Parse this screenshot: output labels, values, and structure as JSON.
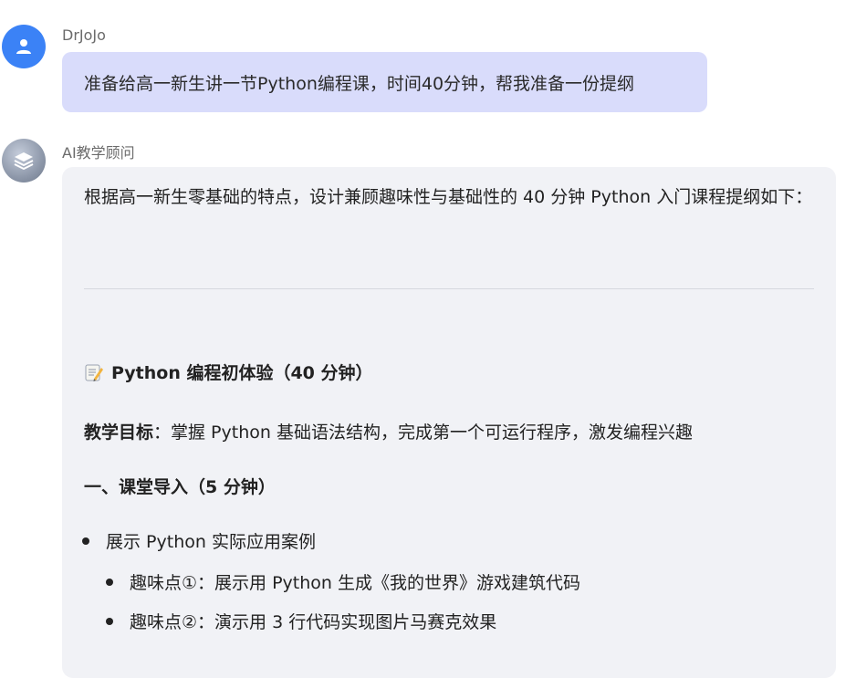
{
  "conversation": {
    "user": {
      "name": "DrJoJo",
      "icon": "user-icon",
      "avatar_color": "#3b82f6",
      "message": "准备给高一新生讲一节Python编程课，时间40分钟，帮我准备一份提纲"
    },
    "assistant": {
      "name": "AI教学顾问",
      "icon": "layers-icon",
      "intro": "根据高一新生零基础的特点，设计兼顾趣味性与基础性的 40 分钟 Python 入门课程提纲如下：",
      "course_title": "Python 编程初体验（40 分钟）",
      "course_title_icon": "memo-icon",
      "objective_label": "教学目标",
      "objective_text": "：掌握 Python 基础语法结构，完成第一个可运行程序，激发编程兴趣",
      "section1_title": "一、课堂导入（5 分钟）",
      "bullets": [
        {
          "text": "展示 Python 实际应用案例",
          "level": 1
        },
        {
          "text": "趣味点①：展示用 Python 生成《我的世界》游戏建筑代码",
          "level": 2
        },
        {
          "text": "趣味点②：演示用 3 行代码实现图片马赛克效果",
          "level": 2
        }
      ]
    }
  },
  "colors": {
    "user_bubble": "#d9dcfb",
    "assistant_bubble": "#f1f2f6"
  }
}
